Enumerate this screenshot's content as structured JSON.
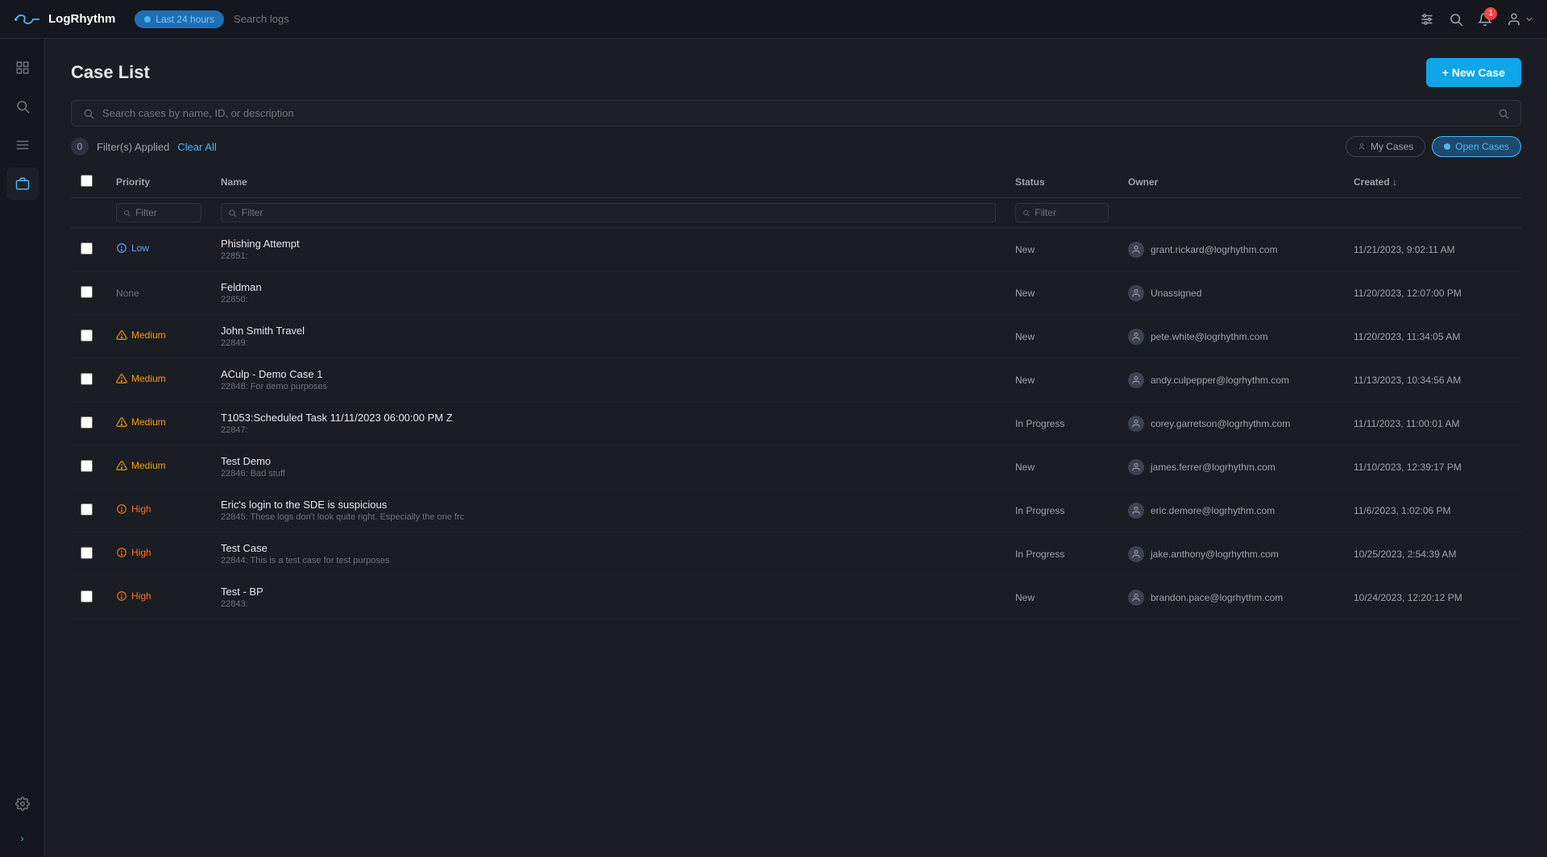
{
  "app": {
    "name": "LogRhythm"
  },
  "topbar": {
    "time_filter": "Last 24 hours",
    "search_placeholder": "Search logs",
    "notification_count": "1",
    "icons": {
      "sliders": "⚡",
      "search": "🔍",
      "bell": "🔔",
      "user": "👤"
    }
  },
  "sidebar": {
    "items": [
      {
        "name": "dashboard",
        "icon": "▦",
        "active": false
      },
      {
        "name": "search",
        "icon": "🔍",
        "active": false
      },
      {
        "name": "list",
        "icon": "☰",
        "active": false
      },
      {
        "name": "cases",
        "icon": "💼",
        "active": true
      },
      {
        "name": "settings",
        "icon": "⚙",
        "active": false
      }
    ]
  },
  "page": {
    "title": "Case List",
    "new_case_label": "+ New Case"
  },
  "search": {
    "placeholder": "Search cases by name, ID, or description"
  },
  "filters": {
    "count": "0",
    "applied_label": "Filter(s) Applied",
    "clear_all_label": "Clear All",
    "my_cases_label": "My Cases",
    "open_cases_label": "Open Cases"
  },
  "table": {
    "columns": [
      {
        "key": "checkbox",
        "label": ""
      },
      {
        "key": "priority",
        "label": "Priority"
      },
      {
        "key": "name",
        "label": "Name"
      },
      {
        "key": "status",
        "label": "Status"
      },
      {
        "key": "owner",
        "label": "Owner"
      },
      {
        "key": "created",
        "label": "Created ↓"
      }
    ],
    "filters": {
      "priority_placeholder": "Filter",
      "name_placeholder": "Filter",
      "status_placeholder": "Filter"
    },
    "rows": [
      {
        "id": "1",
        "priority": "Low",
        "priority_class": "low",
        "priority_icon": "ℹ",
        "name": "Phishing Attempt",
        "case_id": "22851:",
        "status": "New",
        "status_class": "new",
        "owner": "grant.rickard@logrhythm.com",
        "created": "11/21/2023, 9:02:11 AM"
      },
      {
        "id": "2",
        "priority": "None",
        "priority_class": "none",
        "priority_icon": "",
        "name": "Feldman",
        "case_id": "22850:",
        "status": "New",
        "status_class": "new",
        "owner": "Unassigned",
        "created": "11/20/2023, 12:07:00 PM"
      },
      {
        "id": "3",
        "priority": "Medium",
        "priority_class": "medium",
        "priority_icon": "⚠",
        "name": "John Smith Travel",
        "case_id": "22849:",
        "status": "New",
        "status_class": "new",
        "owner": "pete.white@logrhythm.com",
        "created": "11/20/2023, 11:34:05 AM"
      },
      {
        "id": "4",
        "priority": "Medium",
        "priority_class": "medium",
        "priority_icon": "⚠",
        "name": "ACulp - Demo Case 1",
        "case_id": "22848: For demo purposes",
        "status": "New",
        "status_class": "new",
        "owner": "andy.culpepper@logrhythm.com",
        "created": "11/13/2023, 10:34:56 AM"
      },
      {
        "id": "5",
        "priority": "Medium",
        "priority_class": "medium",
        "priority_icon": "⚠",
        "name": "T1053:Scheduled Task 11/11/2023 06:00:00 PM Z",
        "case_id": "22847:",
        "status": "In Progress",
        "status_class": "in-progress",
        "owner": "corey.garretson@logrhythm.com",
        "created": "11/11/2023, 11:00:01 AM"
      },
      {
        "id": "6",
        "priority": "Medium",
        "priority_class": "medium",
        "priority_icon": "⚠",
        "name": "Test Demo",
        "case_id": "22846: Bad stuff",
        "status": "New",
        "status_class": "new",
        "owner": "james.ferrer@logrhythm.com",
        "created": "11/10/2023, 12:39:17 PM"
      },
      {
        "id": "7",
        "priority": "High",
        "priority_class": "high",
        "priority_icon": "⚠",
        "name": "Eric's login to the SDE is suspicious",
        "case_id": "22845: These logs don't look quite right. Especially the one frc",
        "status": "In Progress",
        "status_class": "in-progress",
        "owner": "eric.demore@logrhythm.com",
        "created": "11/6/2023, 1:02:06 PM"
      },
      {
        "id": "8",
        "priority": "High",
        "priority_class": "high",
        "priority_icon": "⚠",
        "name": "Test Case",
        "case_id": "22844: This is a test case for test purposes",
        "status": "In Progress",
        "status_class": "in-progress",
        "owner": "jake.anthony@logrhythm.com",
        "created": "10/25/2023, 2:54:39 AM"
      },
      {
        "id": "9",
        "priority": "High",
        "priority_class": "high",
        "priority_icon": "⚠",
        "name": "Test - BP",
        "case_id": "22843:",
        "status": "New",
        "status_class": "new",
        "owner": "brandon.pace@logrhythm.com",
        "created": "10/24/2023, 12:20:12 PM"
      }
    ]
  }
}
